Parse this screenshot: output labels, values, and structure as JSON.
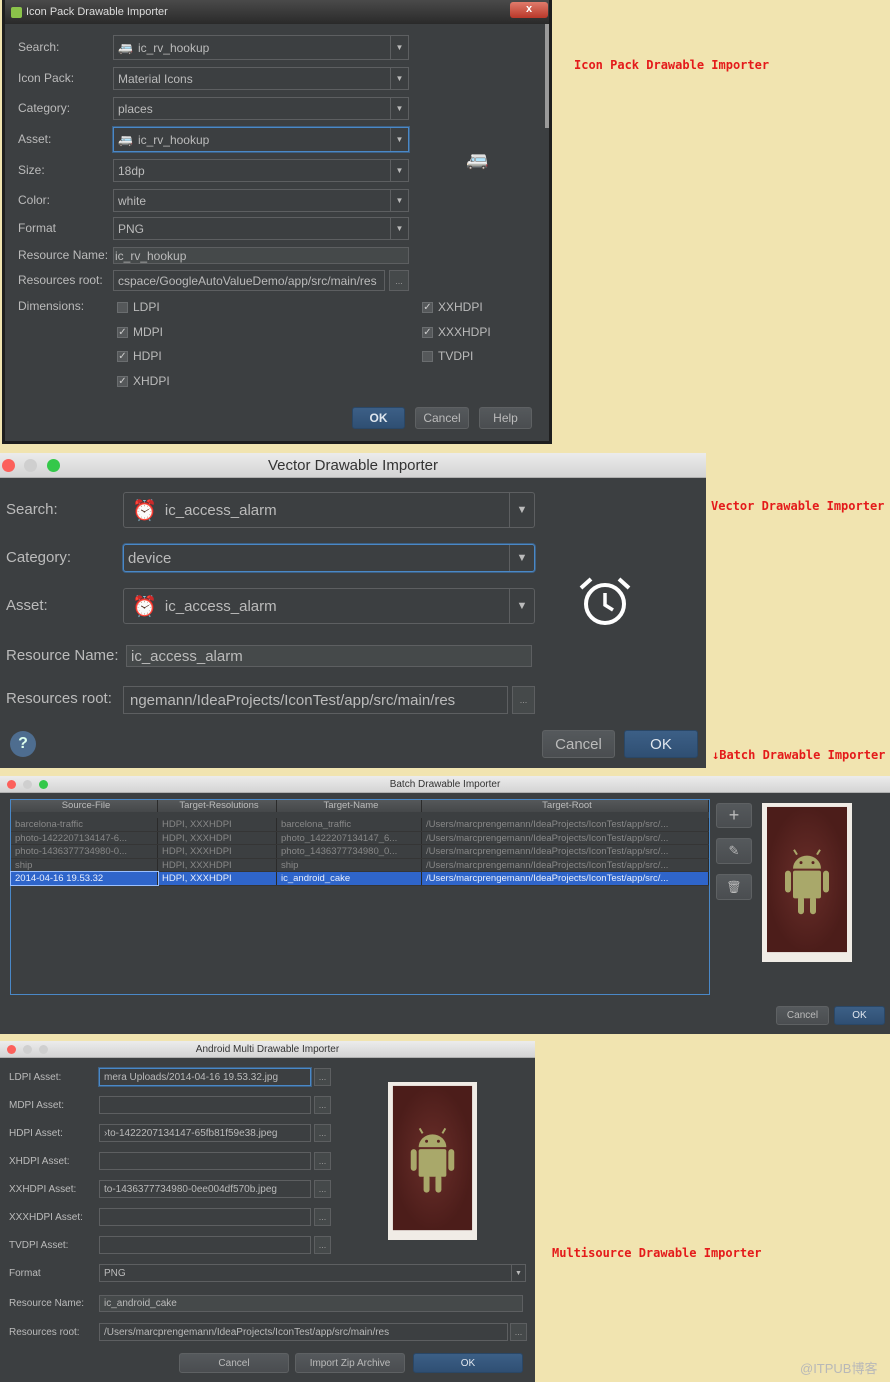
{
  "annotations": {
    "icon_pack": "Icon Pack Drawable Importer",
    "vector": "Vector Drawable Importer",
    "batch": "Batch Drawable Importer",
    "batch_arrow": "↓",
    "multi": "Multisource Drawable Importer",
    "watermark": "@ITPUB博客"
  },
  "colors": {
    "background": "#f1e4b0",
    "dialog": "#3c3f41",
    "annotation": "#e41a1a",
    "selection": "#2f65ca",
    "focus": "#4a88c7"
  },
  "icon_pack": {
    "title": "Icon Pack Drawable Importer",
    "search": {
      "label": "Search:",
      "value": "ic_rv_hookup",
      "icon": "rv-hookup-icon"
    },
    "icon_pack": {
      "label": "Icon Pack:",
      "value": "Material Icons"
    },
    "category": {
      "label": "Category:",
      "value": "places"
    },
    "asset": {
      "label": "Asset:",
      "value": "ic_rv_hookup",
      "icon": "rv-hookup-icon"
    },
    "size": {
      "label": "Size:",
      "value": "18dp"
    },
    "color": {
      "label": "Color:",
      "value": "white"
    },
    "format": {
      "label": "Format",
      "value": "PNG"
    },
    "resource_name": {
      "label": "Resource Name:",
      "value": "ic_rv_hookup"
    },
    "resources_root": {
      "label": "Resources root:",
      "value": "cspace/GoogleAutoValueDemo/app/src/main/res",
      "browse": "..."
    },
    "dimensions_label": "Dimensions:",
    "dimensions": [
      {
        "label": "LDPI",
        "checked": false
      },
      {
        "label": "MDPI",
        "checked": true
      },
      {
        "label": "HDPI",
        "checked": true
      },
      {
        "label": "XHDPI",
        "checked": true
      },
      {
        "label": "XXHDPI",
        "checked": true
      },
      {
        "label": "XXXHDPI",
        "checked": true
      },
      {
        "label": "TVDPI",
        "checked": false
      }
    ],
    "buttons": {
      "ok": "OK",
      "cancel": "Cancel",
      "help": "Help"
    },
    "close": "x"
  },
  "vector": {
    "title": "Vector Drawable Importer",
    "search": {
      "label": "Search:",
      "value": "ic_access_alarm",
      "icon": "alarm-icon"
    },
    "category": {
      "label": "Category:",
      "value": "device"
    },
    "asset": {
      "label": "Asset:",
      "value": "ic_access_alarm",
      "icon": "alarm-icon"
    },
    "resource_name": {
      "label": "Resource Name:",
      "value": "ic_access_alarm"
    },
    "resources_root": {
      "label": "Resources root:",
      "value": "ngemann/IdeaProjects/IconTest/app/src/main/res",
      "browse": "..."
    },
    "help": "?",
    "buttons": {
      "cancel": "Cancel",
      "ok": "OK"
    }
  },
  "batch": {
    "title": "Batch Drawable Importer",
    "columns": [
      "Source-File",
      "Target-Resolutions",
      "Target-Name",
      "Target-Root"
    ],
    "rows": [
      [
        "barcelona-traffic",
        "HDPI, XXXHDPI",
        "barcelona_traffic",
        "/Users/marcprengemann/IdeaProjects/IconTest/app/src/..."
      ],
      [
        "photo-1422207134147-6...",
        "HDPI, XXXHDPI",
        "photo_1422207134147_6...",
        "/Users/marcprengemann/IdeaProjects/IconTest/app/src/..."
      ],
      [
        "photo-1436377734980-0...",
        "HDPI, XXXHDPI",
        "photo_1436377734980_0...",
        "/Users/marcprengemann/IdeaProjects/IconTest/app/src/..."
      ],
      [
        "ship",
        "HDPI, XXXHDPI",
        "ship",
        "/Users/marcprengemann/IdeaProjects/IconTest/app/src/..."
      ],
      [
        "2014-04-16 19.53.32",
        "HDPI, XXXHDPI",
        "ic_android_cake",
        "/Users/marcprengemann/IdeaProjects/IconTest/app/src/..."
      ]
    ],
    "selected_row": 4,
    "buttons": {
      "cancel": "Cancel",
      "ok": "OK"
    }
  },
  "multi": {
    "title": "Android Multi Drawable Importer",
    "assets": [
      {
        "label": "LDPI Asset:",
        "value": "mera Uploads/2014-04-16 19.53.32.jpg"
      },
      {
        "label": "MDPI Asset:",
        "value": ""
      },
      {
        "label": "HDPI Asset:",
        "value": "›to-1422207134147-65fb81f59e38.jpeg"
      },
      {
        "label": "XHDPI Asset:",
        "value": ""
      },
      {
        "label": "XXHDPI Asset:",
        "value": "to-1436377734980-0ee004df570b.jpeg"
      },
      {
        "label": "XXXHDPI Asset:",
        "value": ""
      },
      {
        "label": "TVDPI Asset:",
        "value": ""
      }
    ],
    "browse": "...",
    "format": {
      "label": "Format",
      "value": "PNG"
    },
    "resource_name": {
      "label": "Resource Name:",
      "value": "ic_android_cake"
    },
    "resources_root": {
      "label": "Resources root:",
      "value": "/Users/marcprengemann/IdeaProjects/IconTest/app/src/main/res"
    },
    "buttons": {
      "cancel": "Cancel",
      "import": "Import Zip Archive",
      "ok": "OK"
    }
  }
}
